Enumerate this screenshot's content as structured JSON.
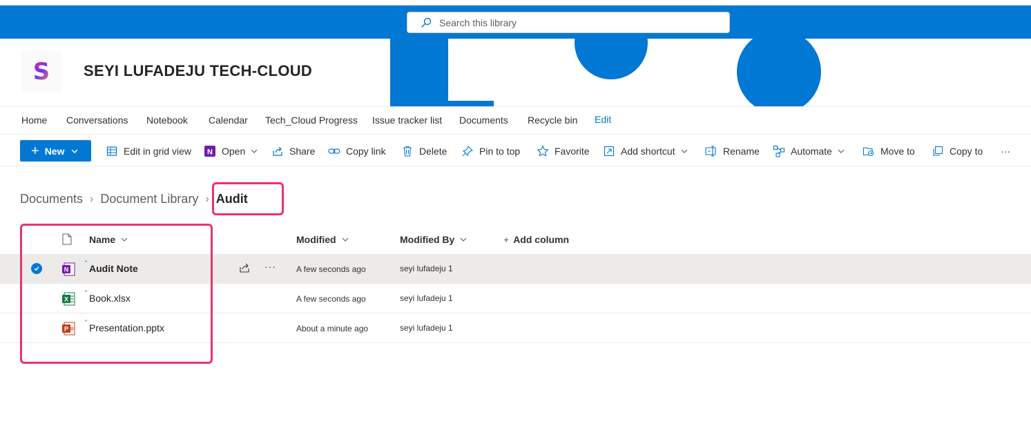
{
  "search": {
    "placeholder": "Search this library"
  },
  "site": {
    "title": "SEYI LUFADEJU TECH-CLOUD",
    "logo_letter": "S"
  },
  "nav": {
    "items": [
      "Home",
      "Conversations",
      "Notebook",
      "Calendar",
      "Tech_Cloud Progress",
      "Issue tracker list",
      "Documents",
      "Recycle bin"
    ],
    "edit": "Edit"
  },
  "toolbar": {
    "new": "New",
    "edit_grid": "Edit in grid view",
    "open": "Open",
    "share": "Share",
    "copy_link": "Copy link",
    "delete": "Delete",
    "pin_to_top": "Pin to top",
    "favorite": "Favorite",
    "add_shortcut": "Add shortcut",
    "rename": "Rename",
    "automate": "Automate",
    "move_to": "Move to",
    "copy_to": "Copy to",
    "more": "···"
  },
  "breadcrumb": {
    "items": [
      "Documents",
      "Document Library"
    ],
    "current": "Audit"
  },
  "columns": {
    "name": "Name",
    "modified": "Modified",
    "modified_by": "Modified By",
    "add_column": "Add column"
  },
  "files": [
    {
      "name": "Audit Note",
      "type": "onenote",
      "modified": "A few seconds ago",
      "modified_by": "seyi lufadeju 1",
      "selected": true
    },
    {
      "name": "Book.xlsx",
      "type": "excel",
      "modified": "A few seconds ago",
      "modified_by": "seyi lufadeju 1",
      "selected": false
    },
    {
      "name": "Presentation.pptx",
      "type": "powerpoint",
      "modified": "About a minute ago",
      "modified_by": "seyi lufadeju 1",
      "selected": false
    }
  ],
  "colors": {
    "accent": "#0078d4",
    "highlight": "#e8336b",
    "selected_row": "#edebe9",
    "onenote": "#7719aa",
    "excel": "#107c41",
    "powerpoint": "#c43e1c"
  }
}
